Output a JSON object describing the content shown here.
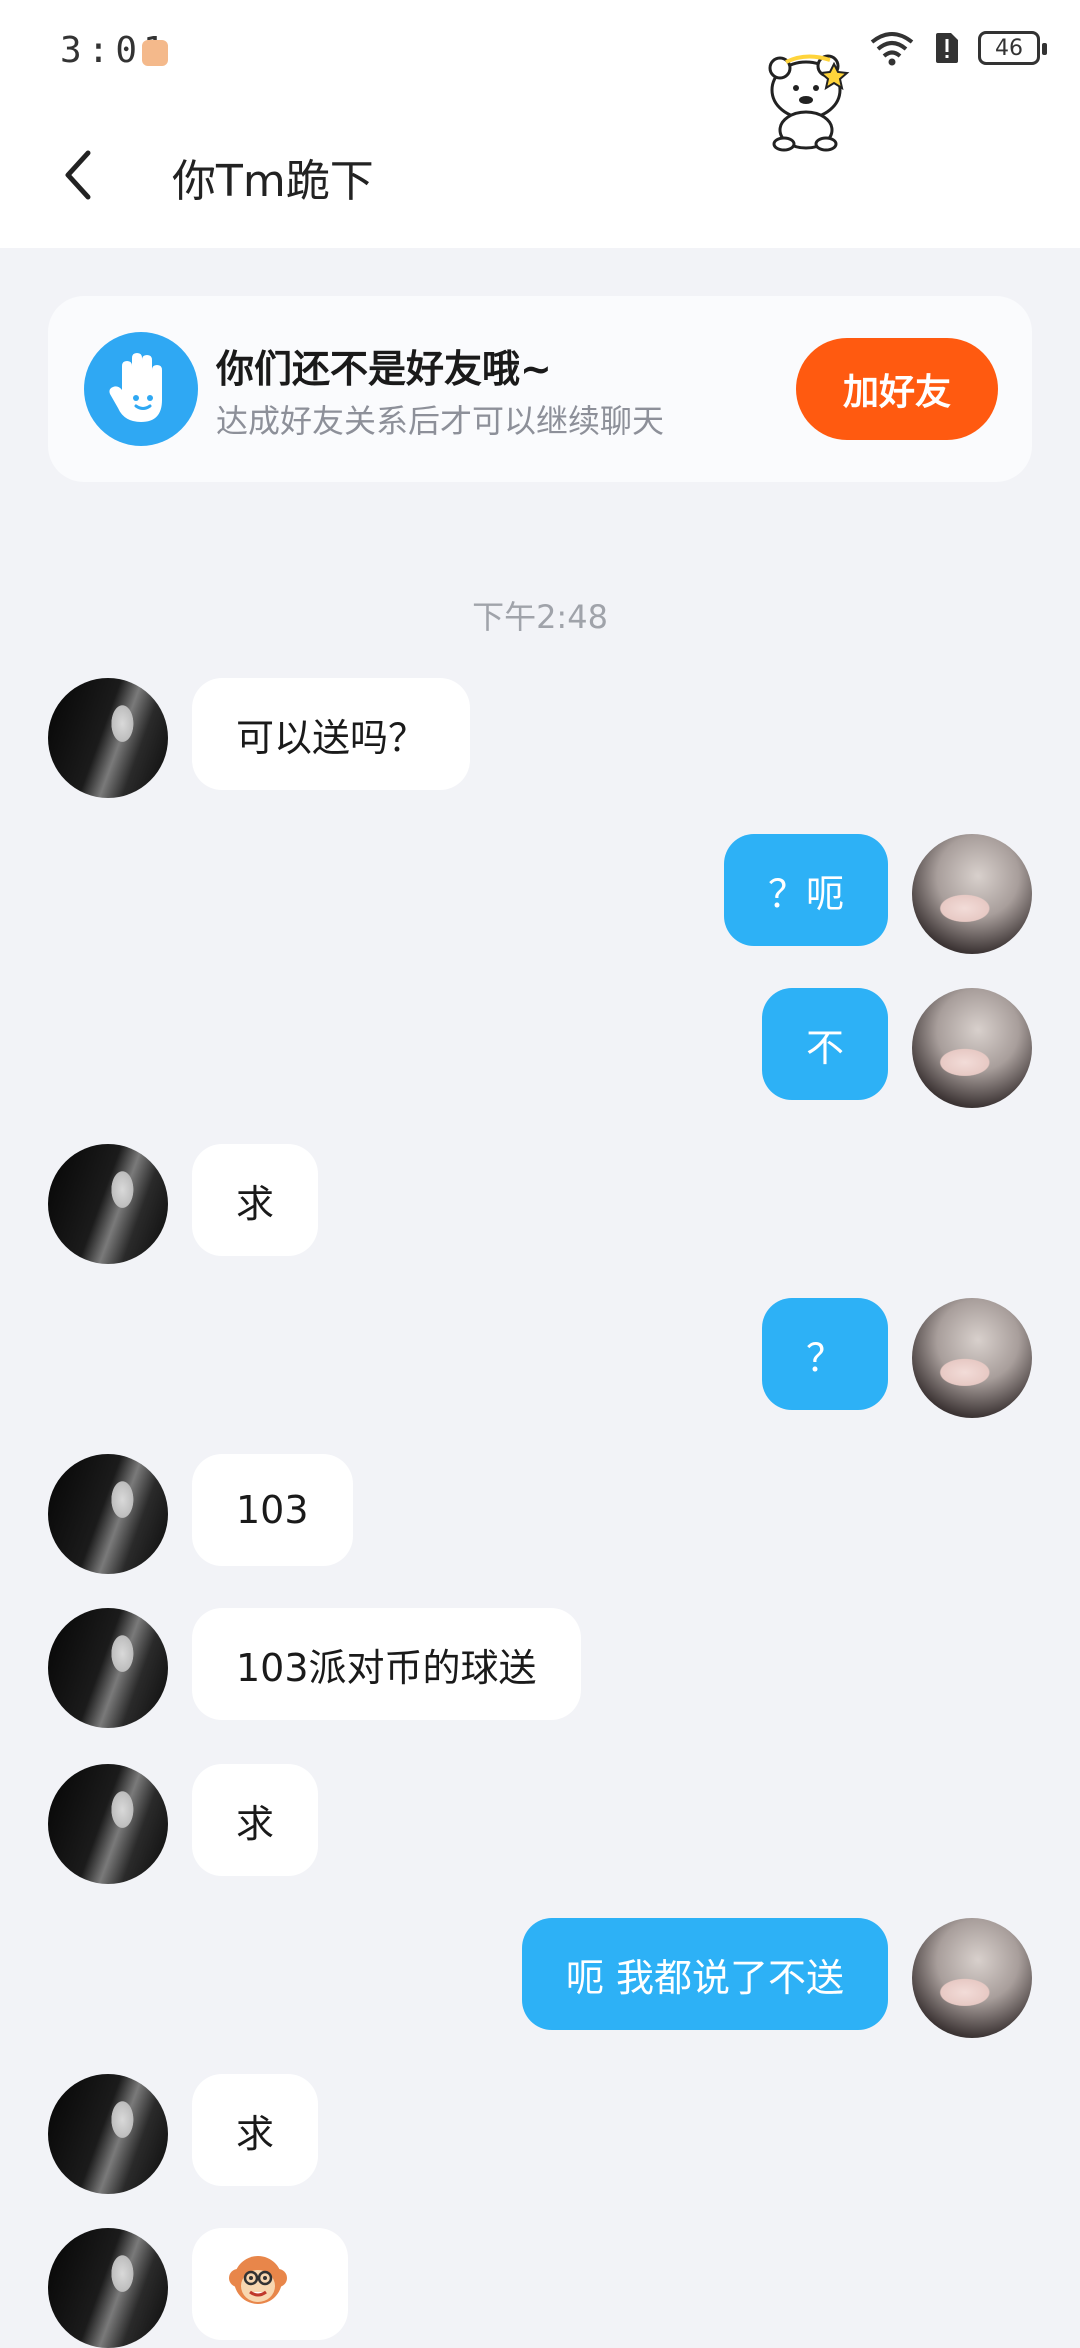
{
  "status_bar": {
    "time": "3:01",
    "battery": "46"
  },
  "header": {
    "title": "你Tm跪下"
  },
  "friend_banner": {
    "title": "你们还不是好友哦~",
    "subtitle": "达成好友关系后才可以继续聊天",
    "button_label": "加好友"
  },
  "timestamp": "下午2:48",
  "messages": [
    {
      "side": "in",
      "text": "可以送吗？"
    },
    {
      "side": "out",
      "text": "？呃"
    },
    {
      "side": "out",
      "text": "不"
    },
    {
      "side": "in",
      "text": "求"
    },
    {
      "side": "out",
      "text": "？"
    },
    {
      "side": "in",
      "text": "103"
    },
    {
      "side": "in",
      "text": "103派对币的球送"
    },
    {
      "side": "in",
      "text": "求"
    },
    {
      "side": "out",
      "text": "呃 我都说了不送"
    },
    {
      "side": "in",
      "text": "求"
    },
    {
      "side": "in",
      "text": "",
      "sticker": "monkey-emoji"
    }
  ],
  "colors": {
    "outgoing_bubble": "#2db1f6",
    "incoming_bubble": "#ffffff",
    "add_friend_button": "#ff5a10",
    "background": "#f2f3f7"
  }
}
